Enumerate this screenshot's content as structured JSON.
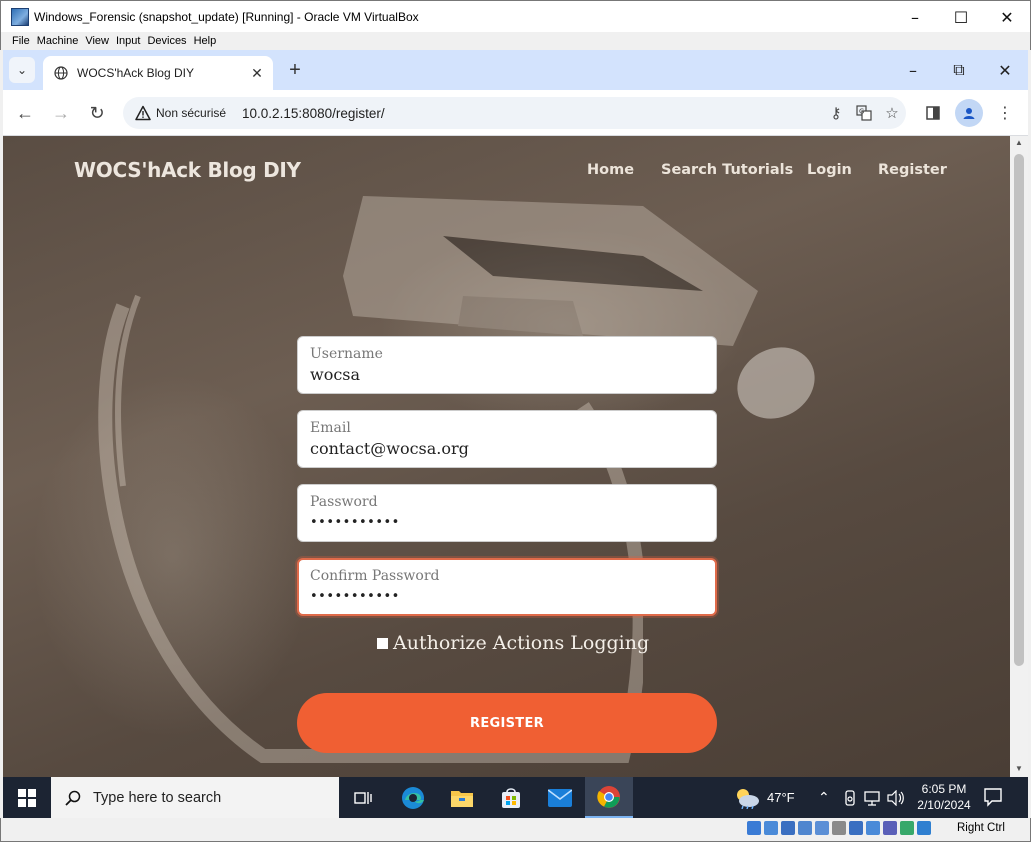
{
  "vbox": {
    "title": "Windows_Forensic (snapshot_update) [Running] - Oracle VM VirtualBox",
    "menu": [
      "File",
      "Machine",
      "View",
      "Input",
      "Devices",
      "Help"
    ],
    "host_key_label": "Right Ctrl"
  },
  "browser": {
    "tab_title": "WOCS'hAck Blog DIY",
    "security_label": "Non sécurisé",
    "url": "10.0.2.15:8080/register/"
  },
  "page": {
    "brand": "WOCS'hAck Blog DIY",
    "nav": [
      "Home",
      "Search Tutorials",
      "Login",
      "Register"
    ],
    "form": {
      "username": {
        "label": "Username",
        "value": "wocsa"
      },
      "email": {
        "label": "Email",
        "value": "contact@wocsa.org"
      },
      "password": {
        "label": "Password",
        "value": "•••••••••••"
      },
      "confirm_password": {
        "label": "Confirm Password",
        "value": "•••••••••••"
      },
      "authorize_logging_label": "Authorize Actions Logging",
      "authorize_logging_checked": false,
      "submit_label": "REGISTER"
    },
    "colors": {
      "accent": "#f05f33",
      "focus_border": "#e06b4a"
    }
  },
  "taskbar": {
    "search_placeholder": "Type here to search",
    "weather": "47°F",
    "time": "6:05 PM",
    "date": "2/10/2024",
    "apps": [
      "task-view-icon",
      "edge-icon",
      "file-explorer-icon",
      "store-icon",
      "mail-icon",
      "chrome-icon"
    ]
  }
}
